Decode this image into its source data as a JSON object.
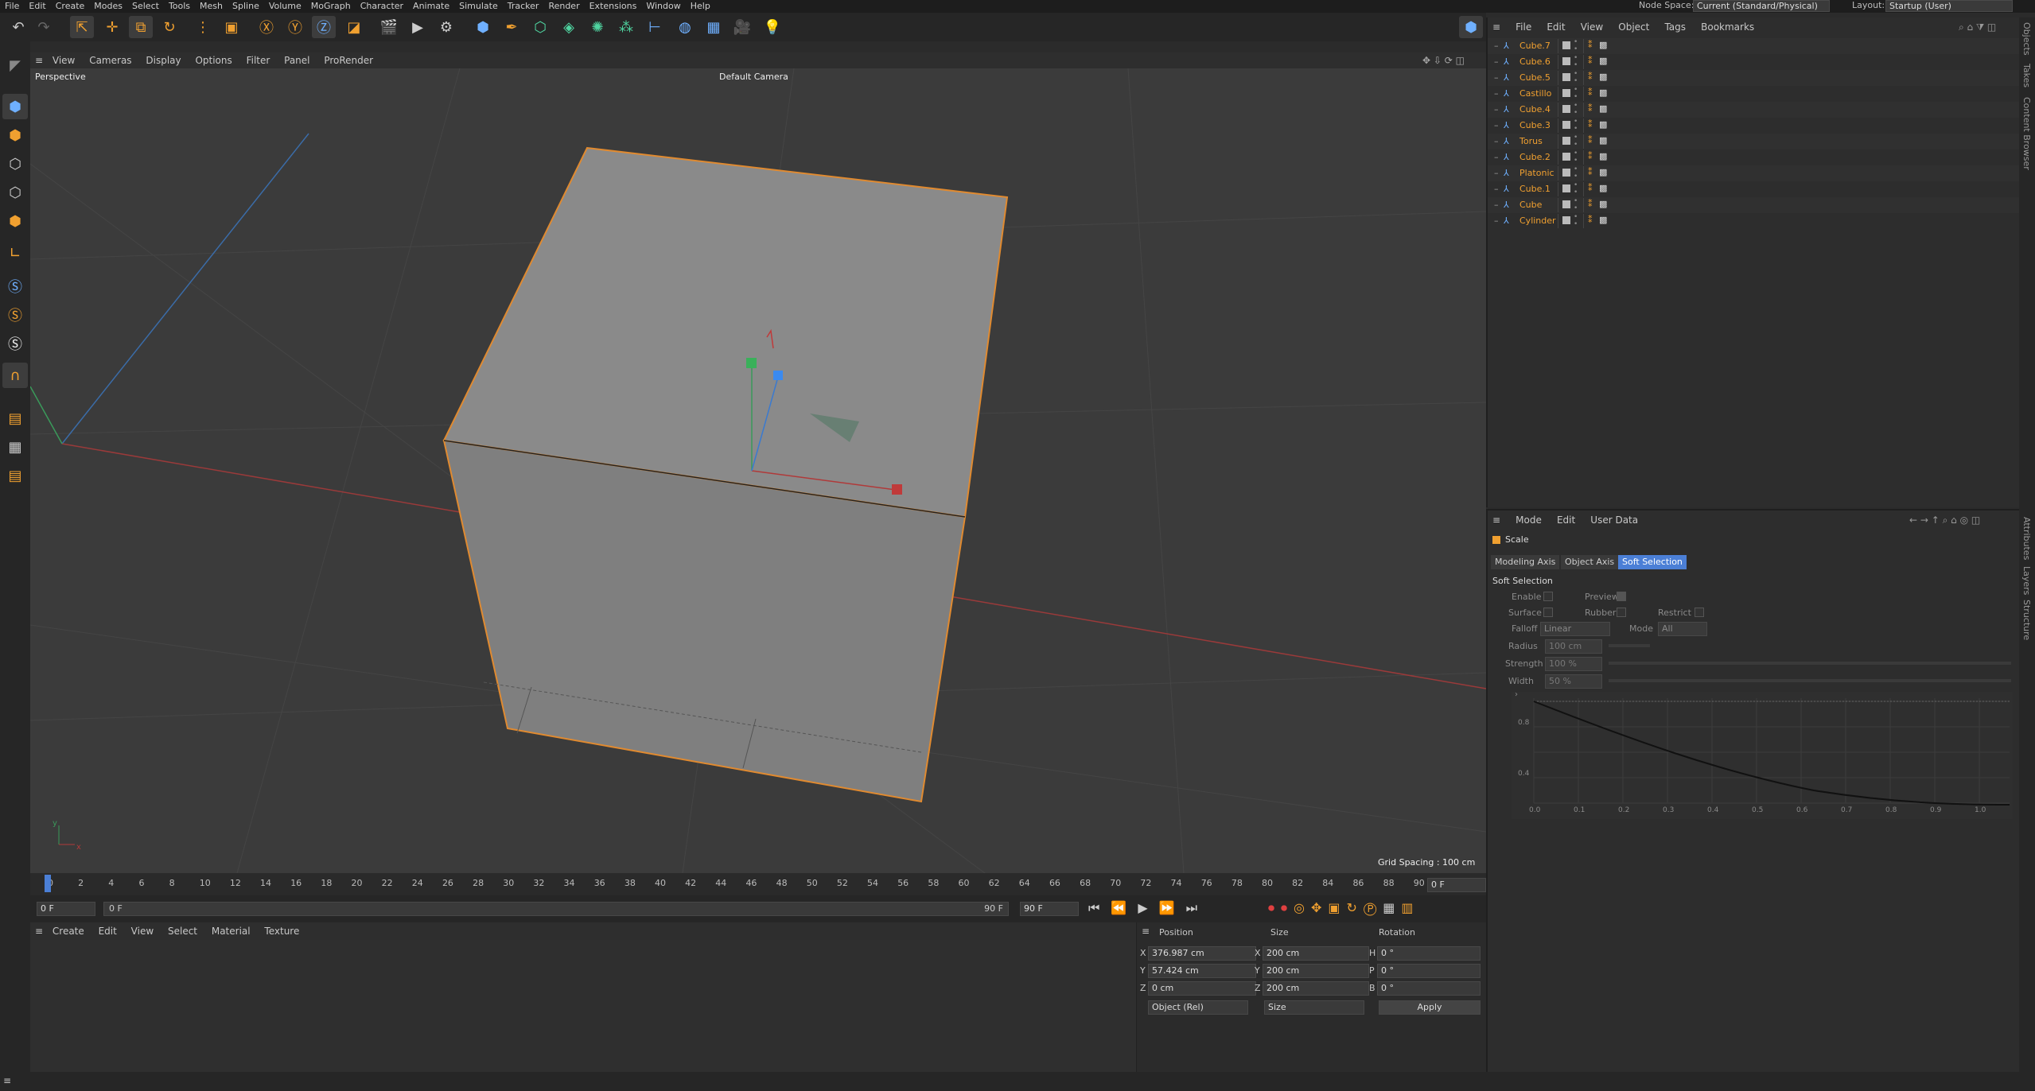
{
  "menubar": {
    "items": [
      "File",
      "Edit",
      "Create",
      "Modes",
      "Select",
      "Tools",
      "Mesh",
      "Spline",
      "Volume",
      "MoGraph",
      "Character",
      "Animate",
      "Simulate",
      "Tracker",
      "Render",
      "Extensions",
      "Window",
      "Help"
    ],
    "node_space_label": "Node Space:",
    "node_space_value": "Current (Standard/Physical)",
    "layout_label": "Layout:",
    "layout_value": "Startup (User)"
  },
  "viewport": {
    "menu": [
      "View",
      "Cameras",
      "Display",
      "Options",
      "Filter",
      "Panel",
      "ProRender"
    ],
    "label": "Perspective",
    "camera": "Default Camera",
    "grid_spacing": "Grid Spacing : 100 cm"
  },
  "timeline": {
    "ticks": [
      "0",
      "2",
      "4",
      "6",
      "8",
      "10",
      "12",
      "14",
      "16",
      "18",
      "20",
      "22",
      "24",
      "26",
      "28",
      "30",
      "32",
      "34",
      "36",
      "38",
      "40",
      "42",
      "44",
      "46",
      "48",
      "50",
      "52",
      "54",
      "56",
      "58",
      "60",
      "62",
      "64",
      "66",
      "68",
      "70",
      "72",
      "74",
      "76",
      "78",
      "80",
      "82",
      "84",
      "86",
      "88",
      "90"
    ],
    "current_frame_right": "0 F",
    "start_field": "0 F",
    "range_start": "0 F",
    "range_end": "90 F",
    "end_field": "90 F"
  },
  "material_menu": [
    "Create",
    "Edit",
    "View",
    "Select",
    "Material",
    "Texture"
  ],
  "coords": {
    "headers": [
      "Position",
      "Size",
      "Rotation"
    ],
    "rows": [
      {
        "axis": "X",
        "pos": "376.987 cm",
        "size_axis": "X",
        "size": "200 cm",
        "rot_axis": "H",
        "rot": "0 °"
      },
      {
        "axis": "Y",
        "pos": "57.424 cm",
        "size_axis": "Y",
        "size": "200 cm",
        "rot_axis": "P",
        "rot": "0 °"
      },
      {
        "axis": "Z",
        "pos": "0 cm",
        "size_axis": "Z",
        "size": "200 cm",
        "rot_axis": "B",
        "rot": "0 °"
      }
    ],
    "mode_select": "Object (Rel)",
    "size_select": "Size",
    "apply": "Apply"
  },
  "objects": {
    "menu": [
      "File",
      "Edit",
      "View",
      "Object",
      "Tags",
      "Bookmarks"
    ],
    "items": [
      "Cube.7",
      "Cube.6",
      "Cube.5",
      "Castillo",
      "Cube.4",
      "Cube.3",
      "Torus",
      "Cube.2",
      "Platonic",
      "Cube.1",
      "Cube",
      "Cylinder"
    ]
  },
  "attributes": {
    "menu": [
      "Mode",
      "Edit",
      "User Data"
    ],
    "tool_name": "Scale",
    "tabs": [
      "Modeling Axis",
      "Object Axis",
      "Soft Selection"
    ],
    "section": "Soft Selection",
    "enable": "Enable",
    "preview": "Preview",
    "surface": "Surface",
    "rubber": "Rubber",
    "restrict": "Restrict",
    "falloff_label": "Falloff",
    "falloff_value": "Linear",
    "mode_label": "Mode",
    "mode_value": "All",
    "radius_label": "Radius",
    "radius_value": "100 cm",
    "strength_label": "Strength",
    "strength_value": "100 %",
    "width_label": "Width",
    "width_value": "50 %",
    "graph_y": [
      "0.8",
      "0.4"
    ],
    "graph_x": [
      "0.0",
      "0.1",
      "0.2",
      "0.3",
      "0.4",
      "0.5",
      "0.6",
      "0.7",
      "0.8",
      "0.9",
      "1.0"
    ]
  },
  "right_strip": {
    "top": [
      "Objects",
      "Takes",
      "Content Browser"
    ],
    "bottom": [
      "Attributes",
      "Layers",
      "Structure"
    ]
  }
}
